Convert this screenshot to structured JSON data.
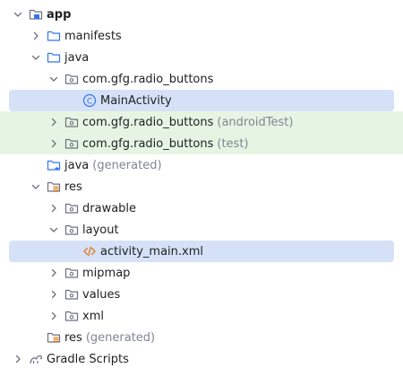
{
  "tree": [
    {
      "label": "app",
      "suffix": "",
      "depth": 0,
      "chev": "down",
      "icon": "module-folder-icon",
      "bold": true
    },
    {
      "label": "manifests",
      "suffix": "",
      "depth": 1,
      "chev": "right",
      "icon": "folder-icon"
    },
    {
      "label": "java",
      "suffix": "",
      "depth": 1,
      "chev": "down",
      "icon": "folder-icon"
    },
    {
      "label": "com.gfg.radio_buttons",
      "suffix": "",
      "depth": 2,
      "chev": "down",
      "icon": "package-icon"
    },
    {
      "label": "MainActivity",
      "suffix": "",
      "depth": 3,
      "chev": "",
      "icon": "class-icon",
      "selected": true
    },
    {
      "label": "com.gfg.radio_buttons",
      "suffix": "(androidTest)",
      "depth": 2,
      "chev": "right",
      "icon": "package-icon",
      "test": true
    },
    {
      "label": "com.gfg.radio_buttons",
      "suffix": "(test)",
      "depth": 2,
      "chev": "right",
      "icon": "package-icon",
      "test": true
    },
    {
      "label": "java",
      "suffix": "(generated)",
      "depth": 1,
      "chev": "",
      "icon": "generated-folder-icon"
    },
    {
      "label": "res",
      "suffix": "",
      "depth": 1,
      "chev": "down",
      "icon": "resources-folder-icon"
    },
    {
      "label": "drawable",
      "suffix": "",
      "depth": 2,
      "chev": "right",
      "icon": "package-icon"
    },
    {
      "label": "layout",
      "suffix": "",
      "depth": 2,
      "chev": "down",
      "icon": "package-icon"
    },
    {
      "label": "activity_main.xml",
      "suffix": "",
      "depth": 3,
      "chev": "",
      "icon": "xml-file-icon",
      "selected": true
    },
    {
      "label": "mipmap",
      "suffix": "",
      "depth": 2,
      "chev": "right",
      "icon": "package-icon"
    },
    {
      "label": "values",
      "suffix": "",
      "depth": 2,
      "chev": "right",
      "icon": "package-icon"
    },
    {
      "label": "xml",
      "suffix": "",
      "depth": 2,
      "chev": "right",
      "icon": "package-icon"
    },
    {
      "label": "res",
      "suffix": "(generated)",
      "depth": 1,
      "chev": "",
      "icon": "resources-folder-icon"
    },
    {
      "label": "Gradle Scripts",
      "suffix": "",
      "depth": 0,
      "chev": "right",
      "icon": "gradle-icon"
    }
  ]
}
